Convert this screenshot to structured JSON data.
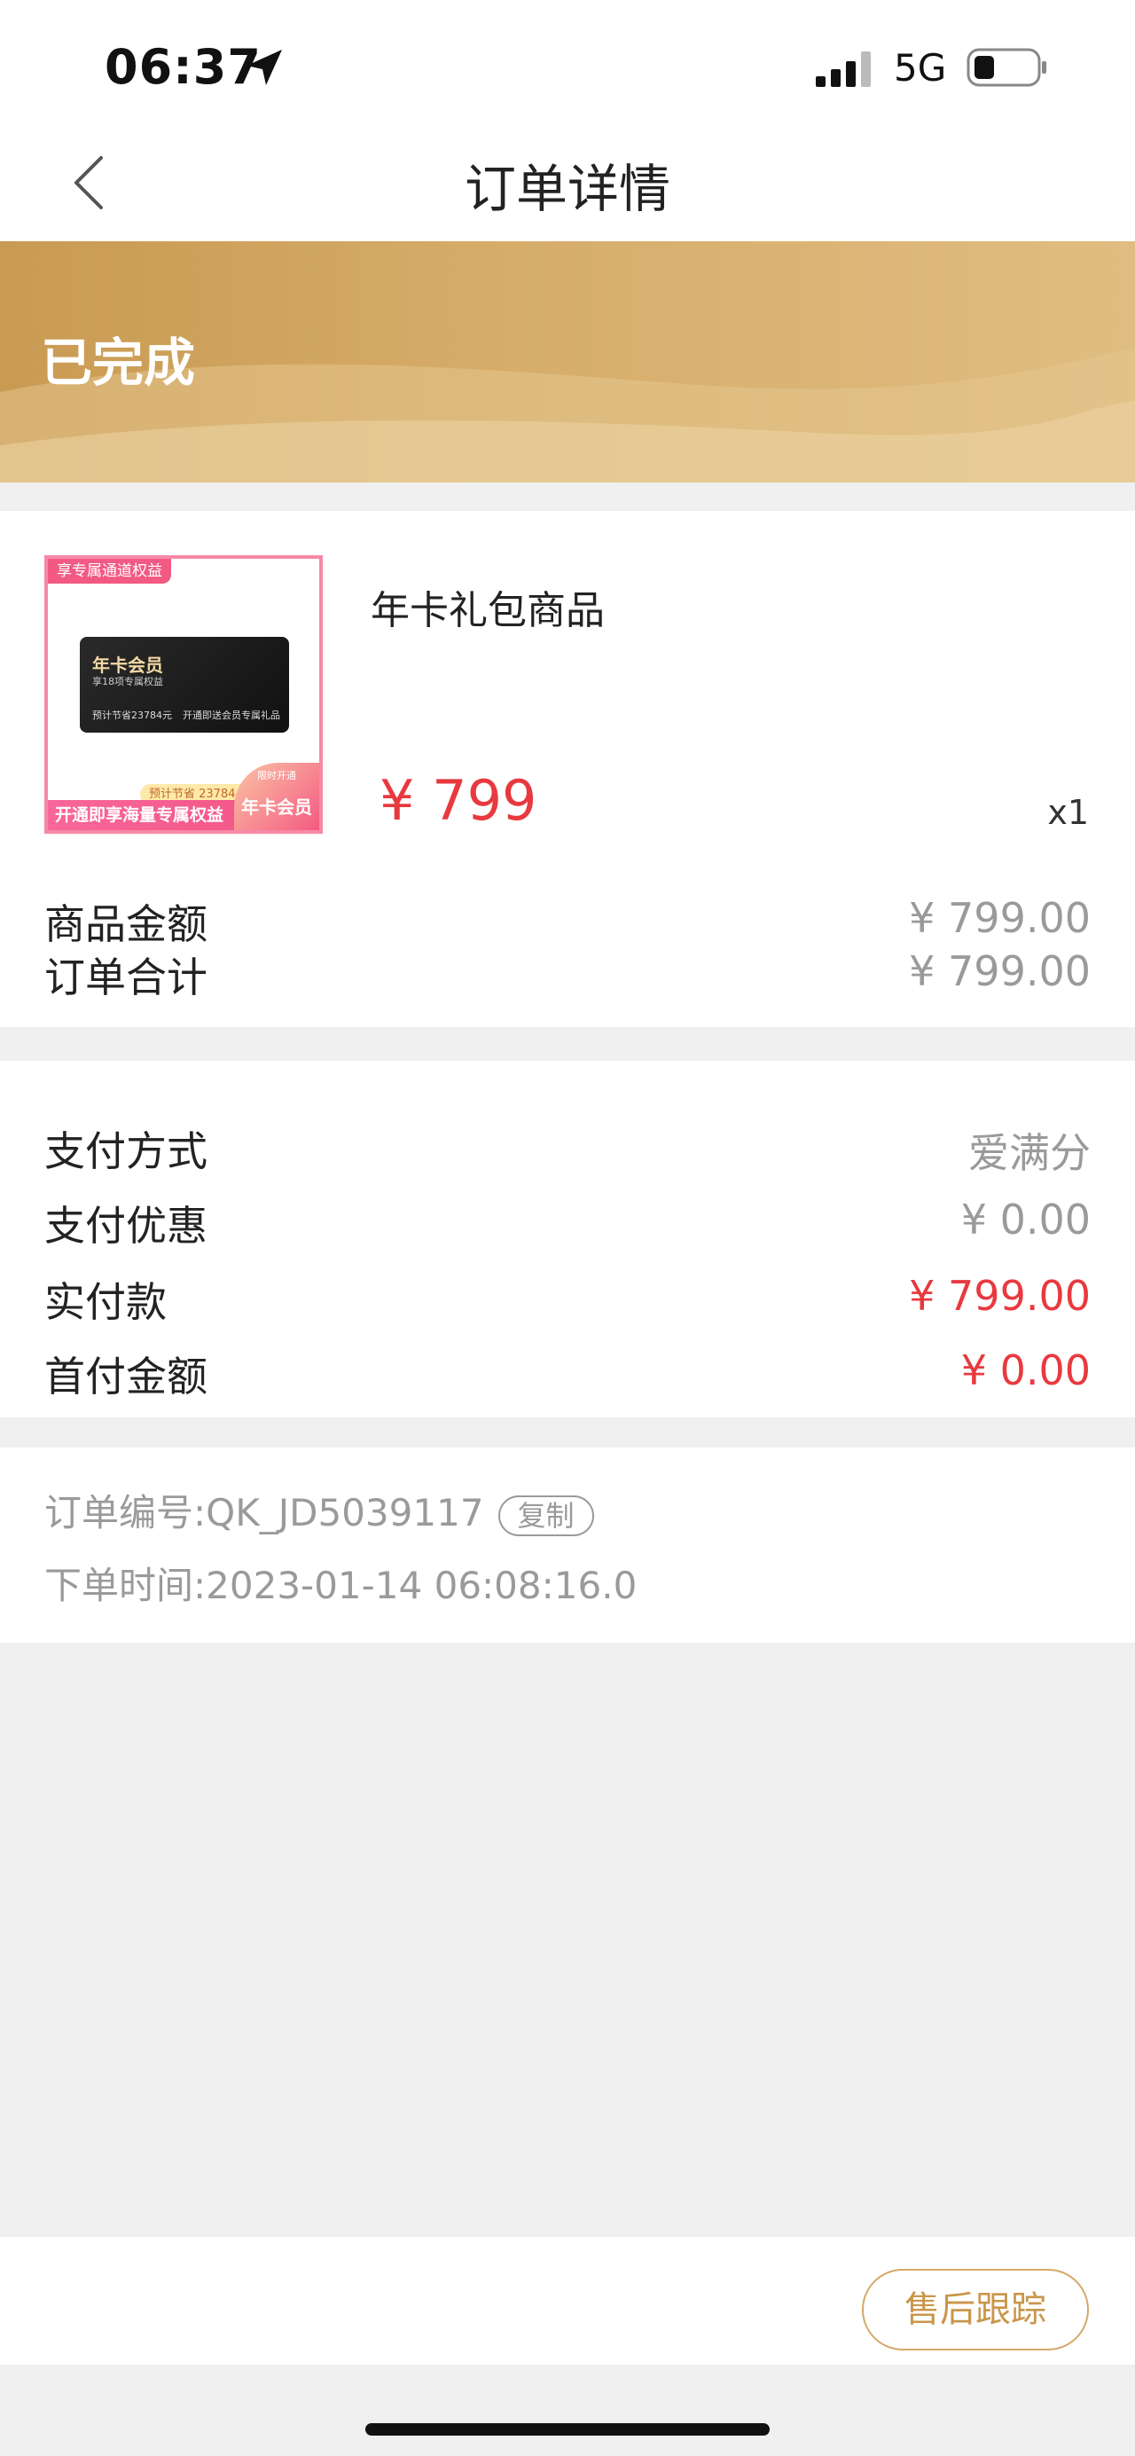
{
  "status_bar": {
    "time": "06:37",
    "network": "5G"
  },
  "nav": {
    "title": "订单详情"
  },
  "order_status": "已完成",
  "product": {
    "name": "年卡礼包商品",
    "price": "¥ 799",
    "quantity": "x1",
    "image": {
      "corner_tag": "享专属通道权益",
      "card_title": "年卡会员",
      "card_subtitle": "享18项专属权益",
      "card_footer_left": "预计节省23784元",
      "card_footer_right": "开通即送会员专属礼品",
      "savings_badge": "预计节省 23784 元",
      "bottom_banner": "开通即享海量专属权益",
      "corner_badge_small": "限时开通",
      "corner_badge": "年卡会员"
    }
  },
  "amounts": [
    {
      "label": "商品金额",
      "value": "¥ 799.00"
    },
    {
      "label": "订单合计",
      "value": "¥ 799.00"
    }
  ],
  "payment": [
    {
      "label": "支付方式",
      "value": "爱满分",
      "highlight": false
    },
    {
      "label": "支付优惠",
      "value": "¥ 0.00",
      "highlight": false
    },
    {
      "label": "实付款",
      "value": "¥ 799.00",
      "highlight": true
    },
    {
      "label": "首付金额",
      "value": "¥ 0.00",
      "highlight": true
    }
  ],
  "order_info": {
    "number_label": "订单编号:",
    "number": "QK_JD5039117",
    "copy_label": "复制",
    "time_label": "下单时间:",
    "time": "2023-01-14 06:08:16.0"
  },
  "bottom_bar": {
    "after_sale_label": "售后跟踪"
  },
  "colors": {
    "accent_gold": "#d4a867",
    "price_red": "#e8393f",
    "muted_gray": "#9a9a9a"
  },
  "icons": [
    "location-arrow-icon",
    "cellular-signal-icon",
    "battery-icon",
    "back-chevron-icon"
  ]
}
